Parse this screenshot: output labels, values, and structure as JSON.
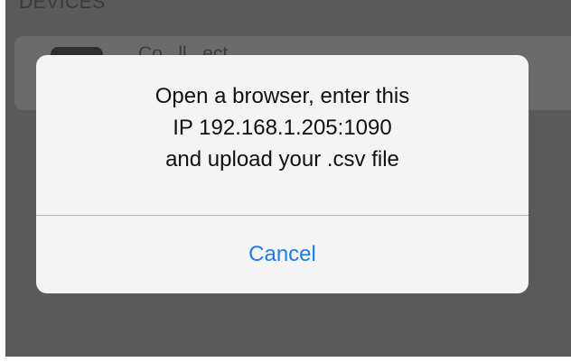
{
  "background": {
    "section_header": "DEVICES",
    "device_row_label": "Co...ll...ect..."
  },
  "alert": {
    "message_lines": [
      "Open a browser, enter this",
      "IP 192.168.1.205:1090",
      "and upload your .csv file"
    ],
    "cancel_label": "Cancel"
  },
  "colors": {
    "accent": "#1a7cf5",
    "dim_background": "#5a5a5a",
    "alert_background": "#f4f4f4"
  }
}
